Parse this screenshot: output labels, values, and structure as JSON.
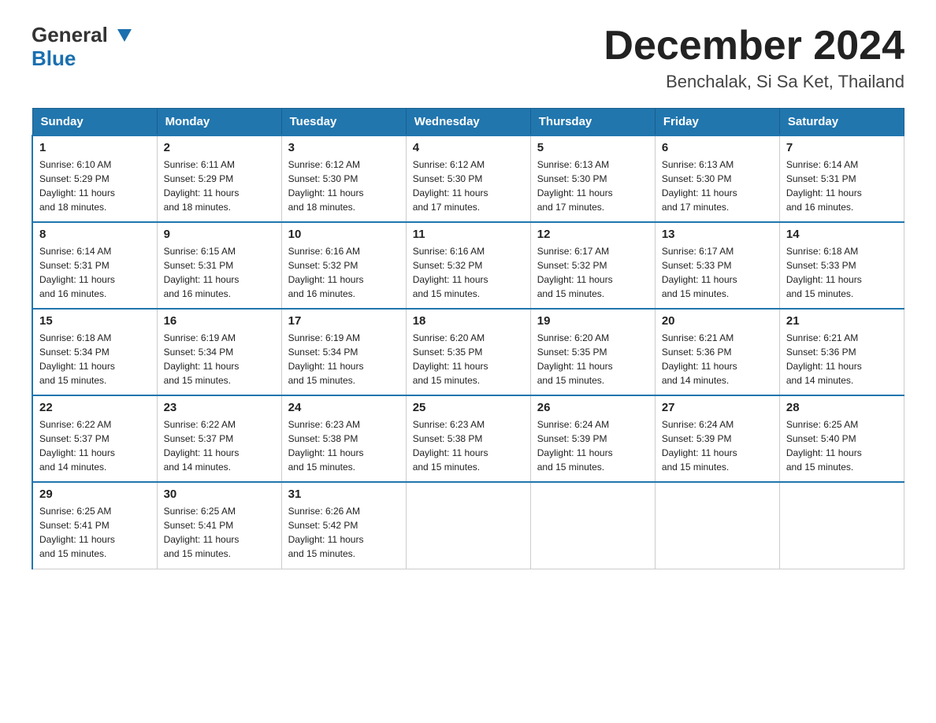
{
  "header": {
    "logo_line1": "General",
    "logo_line2": "Blue",
    "month_title": "December 2024",
    "location": "Benchalak, Si Sa Ket, Thailand"
  },
  "days_of_week": [
    "Sunday",
    "Monday",
    "Tuesday",
    "Wednesday",
    "Thursday",
    "Friday",
    "Saturday"
  ],
  "weeks": [
    [
      {
        "day": "1",
        "sunrise": "6:10 AM",
        "sunset": "5:29 PM",
        "daylight": "11 hours and 18 minutes."
      },
      {
        "day": "2",
        "sunrise": "6:11 AM",
        "sunset": "5:29 PM",
        "daylight": "11 hours and 18 minutes."
      },
      {
        "day": "3",
        "sunrise": "6:12 AM",
        "sunset": "5:30 PM",
        "daylight": "11 hours and 18 minutes."
      },
      {
        "day": "4",
        "sunrise": "6:12 AM",
        "sunset": "5:30 PM",
        "daylight": "11 hours and 17 minutes."
      },
      {
        "day": "5",
        "sunrise": "6:13 AM",
        "sunset": "5:30 PM",
        "daylight": "11 hours and 17 minutes."
      },
      {
        "day": "6",
        "sunrise": "6:13 AM",
        "sunset": "5:30 PM",
        "daylight": "11 hours and 17 minutes."
      },
      {
        "day": "7",
        "sunrise": "6:14 AM",
        "sunset": "5:31 PM",
        "daylight": "11 hours and 16 minutes."
      }
    ],
    [
      {
        "day": "8",
        "sunrise": "6:14 AM",
        "sunset": "5:31 PM",
        "daylight": "11 hours and 16 minutes."
      },
      {
        "day": "9",
        "sunrise": "6:15 AM",
        "sunset": "5:31 PM",
        "daylight": "11 hours and 16 minutes."
      },
      {
        "day": "10",
        "sunrise": "6:16 AM",
        "sunset": "5:32 PM",
        "daylight": "11 hours and 16 minutes."
      },
      {
        "day": "11",
        "sunrise": "6:16 AM",
        "sunset": "5:32 PM",
        "daylight": "11 hours and 15 minutes."
      },
      {
        "day": "12",
        "sunrise": "6:17 AM",
        "sunset": "5:32 PM",
        "daylight": "11 hours and 15 minutes."
      },
      {
        "day": "13",
        "sunrise": "6:17 AM",
        "sunset": "5:33 PM",
        "daylight": "11 hours and 15 minutes."
      },
      {
        "day": "14",
        "sunrise": "6:18 AM",
        "sunset": "5:33 PM",
        "daylight": "11 hours and 15 minutes."
      }
    ],
    [
      {
        "day": "15",
        "sunrise": "6:18 AM",
        "sunset": "5:34 PM",
        "daylight": "11 hours and 15 minutes."
      },
      {
        "day": "16",
        "sunrise": "6:19 AM",
        "sunset": "5:34 PM",
        "daylight": "11 hours and 15 minutes."
      },
      {
        "day": "17",
        "sunrise": "6:19 AM",
        "sunset": "5:34 PM",
        "daylight": "11 hours and 15 minutes."
      },
      {
        "day": "18",
        "sunrise": "6:20 AM",
        "sunset": "5:35 PM",
        "daylight": "11 hours and 15 minutes."
      },
      {
        "day": "19",
        "sunrise": "6:20 AM",
        "sunset": "5:35 PM",
        "daylight": "11 hours and 15 minutes."
      },
      {
        "day": "20",
        "sunrise": "6:21 AM",
        "sunset": "5:36 PM",
        "daylight": "11 hours and 14 minutes."
      },
      {
        "day": "21",
        "sunrise": "6:21 AM",
        "sunset": "5:36 PM",
        "daylight": "11 hours and 14 minutes."
      }
    ],
    [
      {
        "day": "22",
        "sunrise": "6:22 AM",
        "sunset": "5:37 PM",
        "daylight": "11 hours and 14 minutes."
      },
      {
        "day": "23",
        "sunrise": "6:22 AM",
        "sunset": "5:37 PM",
        "daylight": "11 hours and 14 minutes."
      },
      {
        "day": "24",
        "sunrise": "6:23 AM",
        "sunset": "5:38 PM",
        "daylight": "11 hours and 15 minutes."
      },
      {
        "day": "25",
        "sunrise": "6:23 AM",
        "sunset": "5:38 PM",
        "daylight": "11 hours and 15 minutes."
      },
      {
        "day": "26",
        "sunrise": "6:24 AM",
        "sunset": "5:39 PM",
        "daylight": "11 hours and 15 minutes."
      },
      {
        "day": "27",
        "sunrise": "6:24 AM",
        "sunset": "5:39 PM",
        "daylight": "11 hours and 15 minutes."
      },
      {
        "day": "28",
        "sunrise": "6:25 AM",
        "sunset": "5:40 PM",
        "daylight": "11 hours and 15 minutes."
      }
    ],
    [
      {
        "day": "29",
        "sunrise": "6:25 AM",
        "sunset": "5:41 PM",
        "daylight": "11 hours and 15 minutes."
      },
      {
        "day": "30",
        "sunrise": "6:25 AM",
        "sunset": "5:41 PM",
        "daylight": "11 hours and 15 minutes."
      },
      {
        "day": "31",
        "sunrise": "6:26 AM",
        "sunset": "5:42 PM",
        "daylight": "11 hours and 15 minutes."
      },
      null,
      null,
      null,
      null
    ]
  ],
  "labels": {
    "sunrise": "Sunrise:",
    "sunset": "Sunset:",
    "daylight": "Daylight:"
  }
}
